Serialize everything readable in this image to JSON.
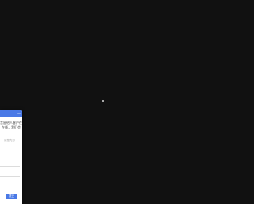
{
  "panel": {
    "collapse_icon": "minus-icon",
    "message_line1": "言留给人客户在",
    "message_line2": "在线，我们会",
    "hint": "请您先写",
    "submit_label": "提交",
    "accent_color": "#4a79e6"
  }
}
